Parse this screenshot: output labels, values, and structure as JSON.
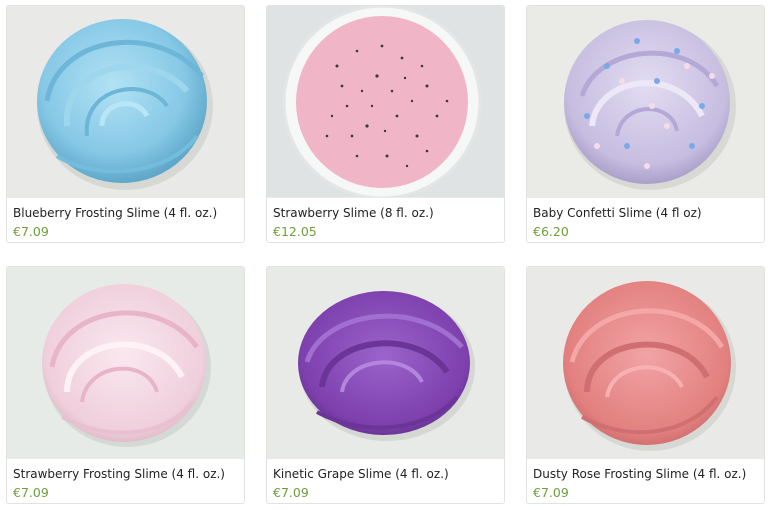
{
  "products": [
    {
      "title": "Blueberry Frosting Slime (4 fl. oz.)",
      "price": "€7.09",
      "color": "#8dcbe6"
    },
    {
      "title": "Strawberry Slime (8 fl. oz.)",
      "price": "€12.05",
      "color": "#f2b7c8"
    },
    {
      "title": "Baby Confetti Slime (4 fl oz)",
      "price": "€6.20",
      "color": "#c9c1e1"
    },
    {
      "title": "Strawberry Frosting Slime (4 fl. oz.)",
      "price": "€7.09",
      "color": "#f2d3df"
    },
    {
      "title": "Kinetic Grape Slime (4 fl. oz.)",
      "price": "€7.09",
      "color": "#8a4fb8"
    },
    {
      "title": "Dusty Rose Frosting Slime (4 fl. oz.)",
      "price": "€7.09",
      "color": "#e58487"
    }
  ]
}
